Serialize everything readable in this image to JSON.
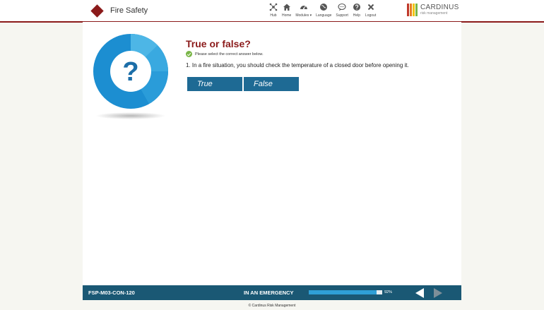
{
  "header": {
    "title": "Fire Safety",
    "nav": [
      {
        "label": "Hub",
        "icon": "hub-icon"
      },
      {
        "label": "Home",
        "icon": "home-icon"
      },
      {
        "label": "Modules ▾",
        "icon": "modules-icon"
      },
      {
        "label": "Language",
        "icon": "globe-icon"
      },
      {
        "label": "Support",
        "icon": "chat-icon"
      },
      {
        "label": "Help",
        "icon": "help-icon"
      },
      {
        "label": "Logout",
        "icon": "close-icon"
      }
    ],
    "logo": {
      "word1": "CARDINUS",
      "word2": "risk management"
    }
  },
  "question": {
    "title": "True or false?",
    "instruction": "Please select the correct answer below.",
    "text": "1. In a fire situation, you should check the temperature of a closed door before opening it.",
    "answers": [
      "True",
      "False"
    ]
  },
  "footer": {
    "code": "FSP-M03-CON-120",
    "section": "IN AN EMERGENCY",
    "progress_percent": 92,
    "progress_label": "92%",
    "copyright": "© Cardinus Risk Management"
  },
  "colors": {
    "brand_red": "#8b1a1a",
    "answer_button": "#1e6a94",
    "footer_bg": "#1a5874",
    "progress_fill": "#2f9fd6",
    "logo_bars": [
      "#c0392b",
      "#e67e22",
      "#f1c40f",
      "#7ab648",
      "#2c7fb8"
    ]
  }
}
